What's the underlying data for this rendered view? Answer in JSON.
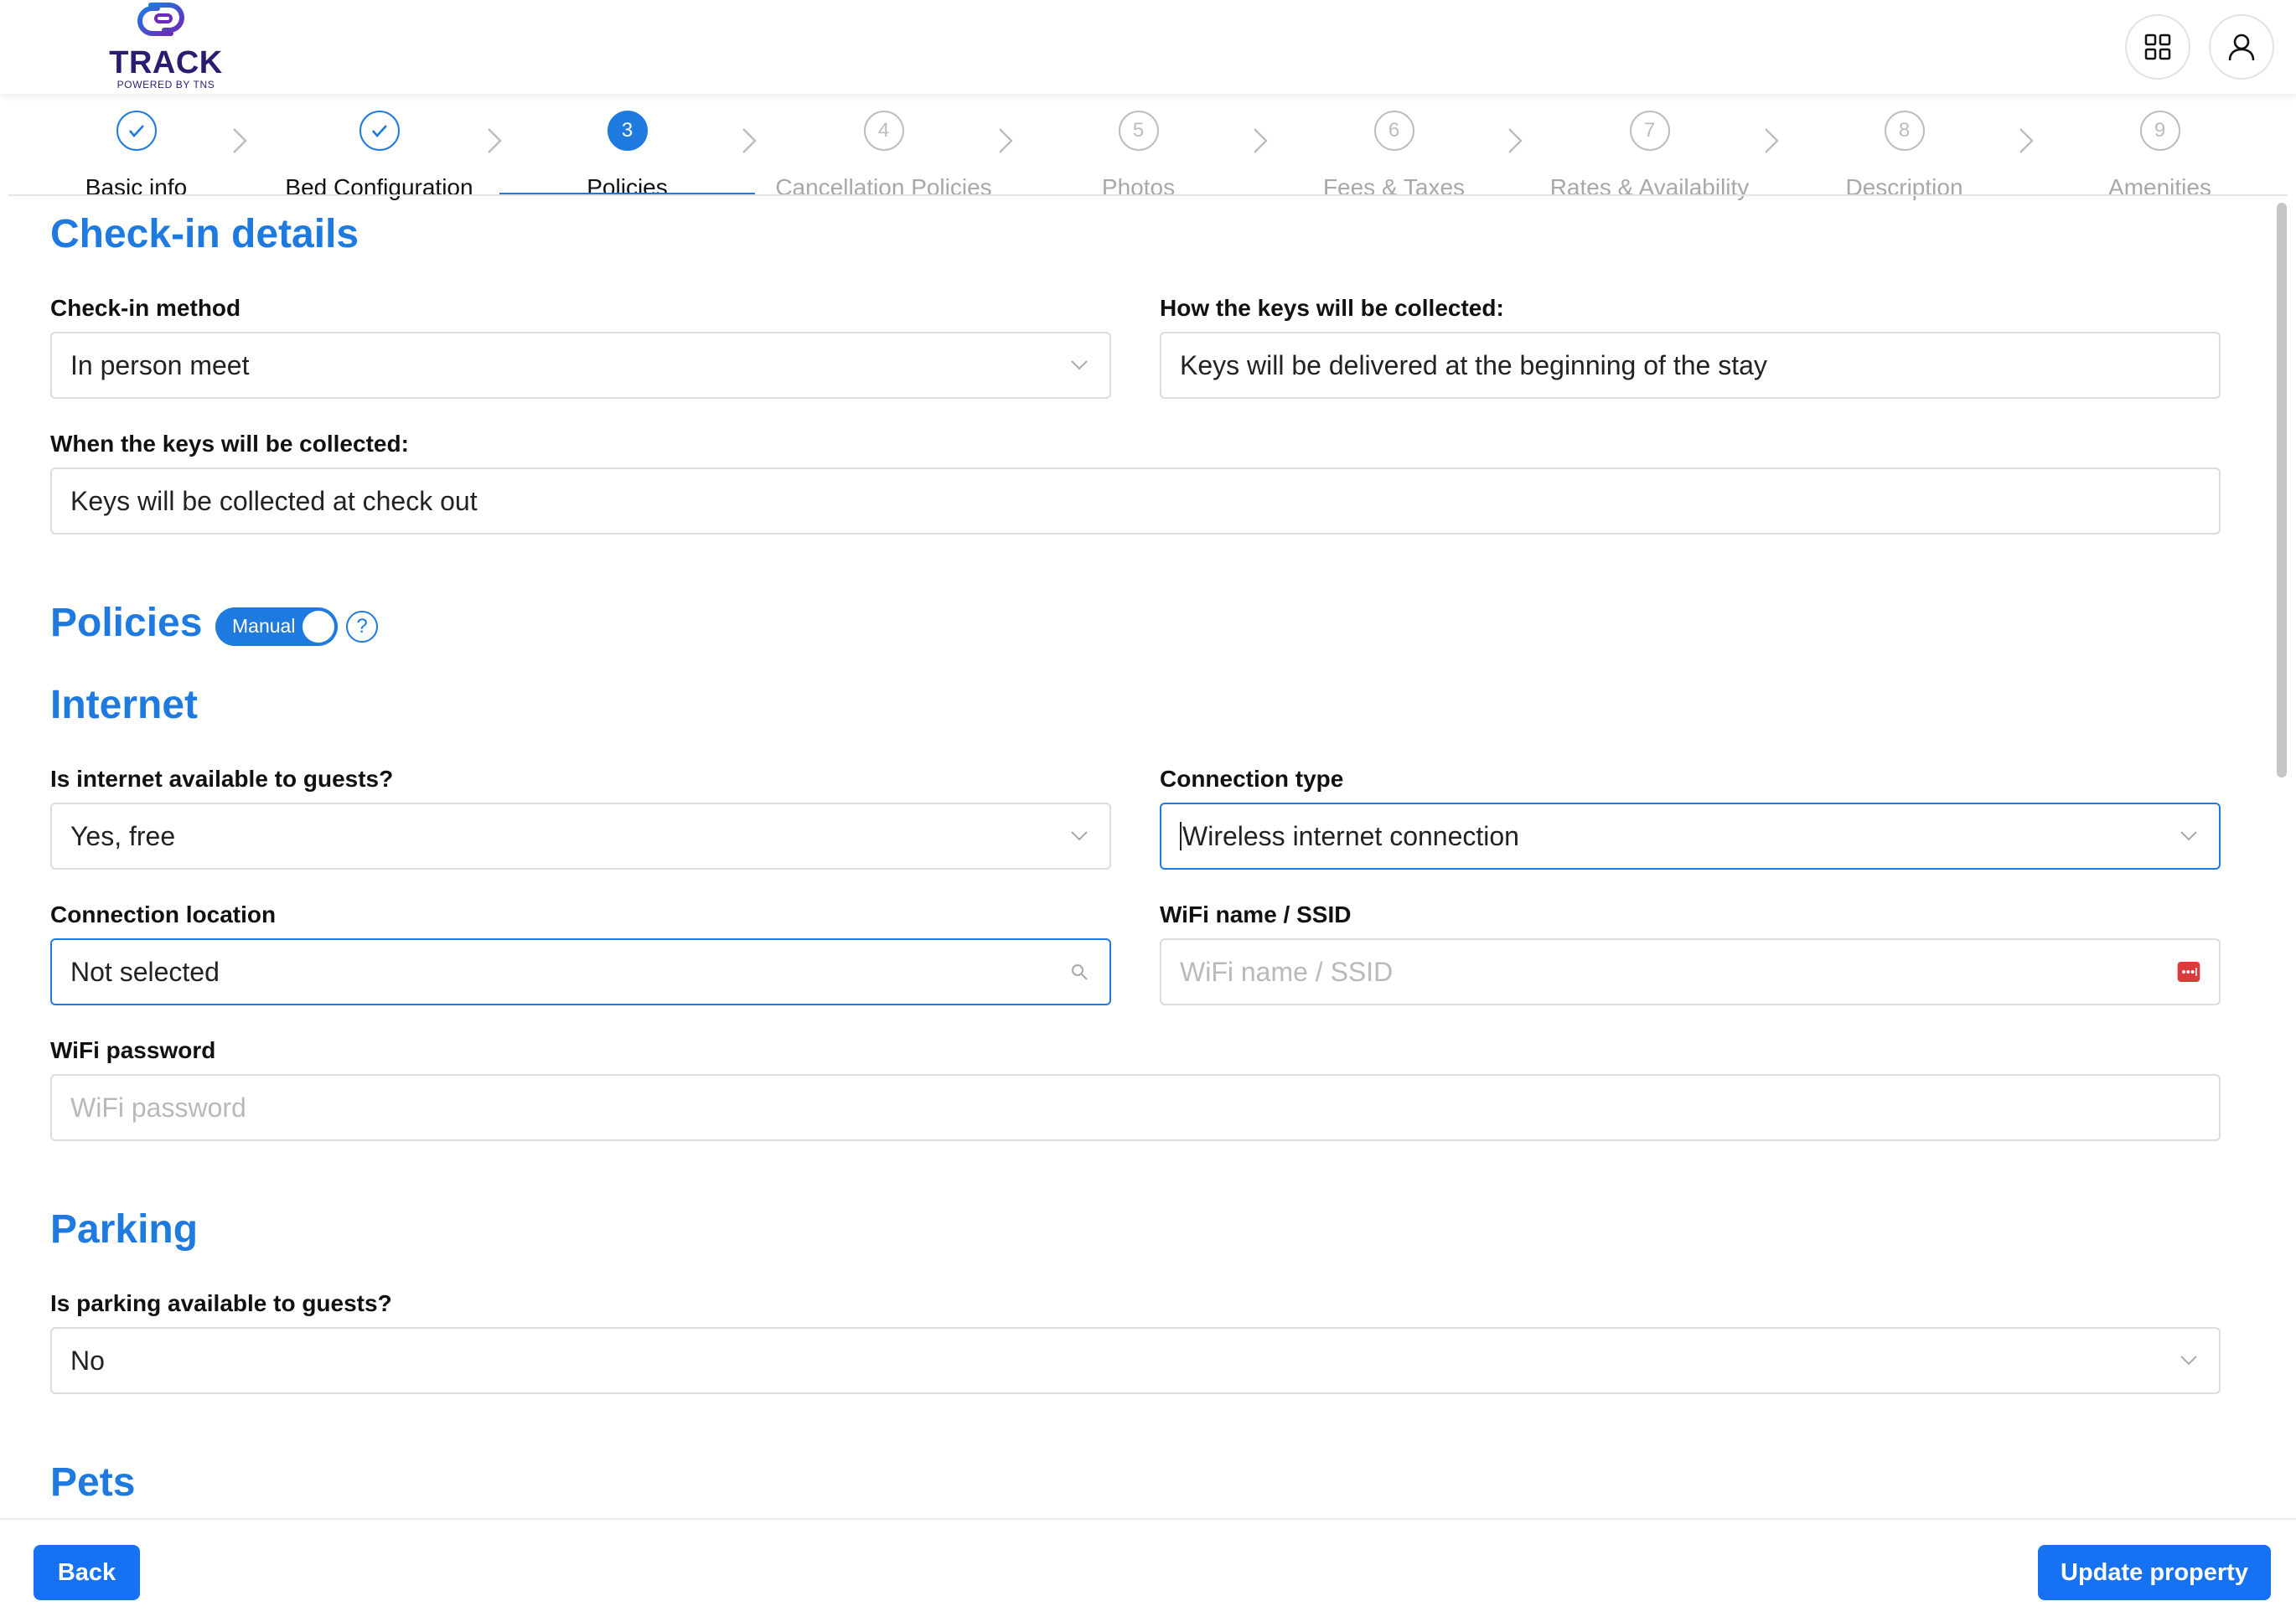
{
  "brand": {
    "name": "TRACK",
    "tagline": "POWERED BY TNS",
    "accent": "#1f7ae0",
    "logo_color": "#2b1c6f"
  },
  "header": {
    "apps_icon": "grid-icon",
    "user_icon": "user-icon"
  },
  "stepper": {
    "steps": [
      {
        "number": "1",
        "label": "Basic info",
        "state": "done"
      },
      {
        "number": "2",
        "label": "Bed Configuration",
        "state": "done"
      },
      {
        "number": "3",
        "label": "Policies",
        "state": "active"
      },
      {
        "number": "4",
        "label": "Cancellation Policies",
        "state": "pending"
      },
      {
        "number": "5",
        "label": "Photos",
        "state": "pending"
      },
      {
        "number": "6",
        "label": "Fees & Taxes",
        "state": "pending"
      },
      {
        "number": "7",
        "label": "Rates & Availability",
        "state": "pending"
      },
      {
        "number": "8",
        "label": "Description",
        "state": "pending"
      },
      {
        "number": "9",
        "label": "Amenities",
        "state": "pending"
      }
    ]
  },
  "checkin": {
    "title": "Check-in details",
    "method": {
      "label": "Check-in method",
      "value": "In person meet"
    },
    "keys_how": {
      "label": "How the keys will be collected:",
      "value": "Keys will be delivered at the beginning of the stay"
    },
    "keys_when": {
      "label": "When the keys will be collected:",
      "value": "Keys will be collected at check out"
    }
  },
  "policies": {
    "title": "Policies",
    "toggle_label": "Manual",
    "help": "?"
  },
  "internet": {
    "title": "Internet",
    "available": {
      "label": "Is internet available to guests?",
      "value": "Yes, free"
    },
    "connection_type": {
      "label": "Connection type",
      "value": "Wireless internet connection"
    },
    "location": {
      "label": "Connection location",
      "value": "Not selected"
    },
    "ssid": {
      "label": "WiFi name / SSID",
      "placeholder": "WiFi name / SSID"
    },
    "password": {
      "label": "WiFi password",
      "placeholder": "WiFi password"
    }
  },
  "parking": {
    "title": "Parking",
    "available": {
      "label": "Is parking available to guests?",
      "value": "No"
    }
  },
  "pets": {
    "title": "Pets"
  },
  "footer": {
    "back_label": "Back",
    "update_label": "Update property"
  }
}
